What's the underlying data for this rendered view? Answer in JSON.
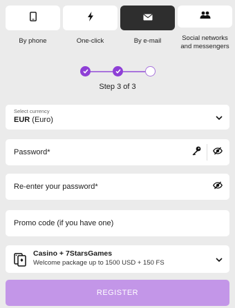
{
  "tabs": [
    {
      "label": "By phone",
      "icon": "phone-icon"
    },
    {
      "label": "One-click",
      "icon": "lightning-icon"
    },
    {
      "label": "By e-mail",
      "icon": "envelope-icon"
    },
    {
      "label_line1": "Social networks",
      "label_line2": "and messengers",
      "icon": "people-icon"
    }
  ],
  "active_tab": "By e-mail",
  "stepper": {
    "step_text": "Step 3 of 3",
    "completed": 2,
    "total": 3
  },
  "currency": {
    "small_label": "Select currency",
    "code": "EUR",
    "name": "(Euro)"
  },
  "password": {
    "label": "Password*"
  },
  "reenter_password": {
    "label": "Re-enter your password*"
  },
  "promo": {
    "label": "Promo code (if you have one)"
  },
  "bonus": {
    "title": "Casino + 7StarsGames",
    "subtitle": "Welcome package up to 1500 USD + 150 FS"
  },
  "register_label": "REGISTER",
  "colors": {
    "accent": "#8e3fd6",
    "button": "#c396e8",
    "active_tab": "#2e2e2e",
    "background": "#ebebeb"
  }
}
